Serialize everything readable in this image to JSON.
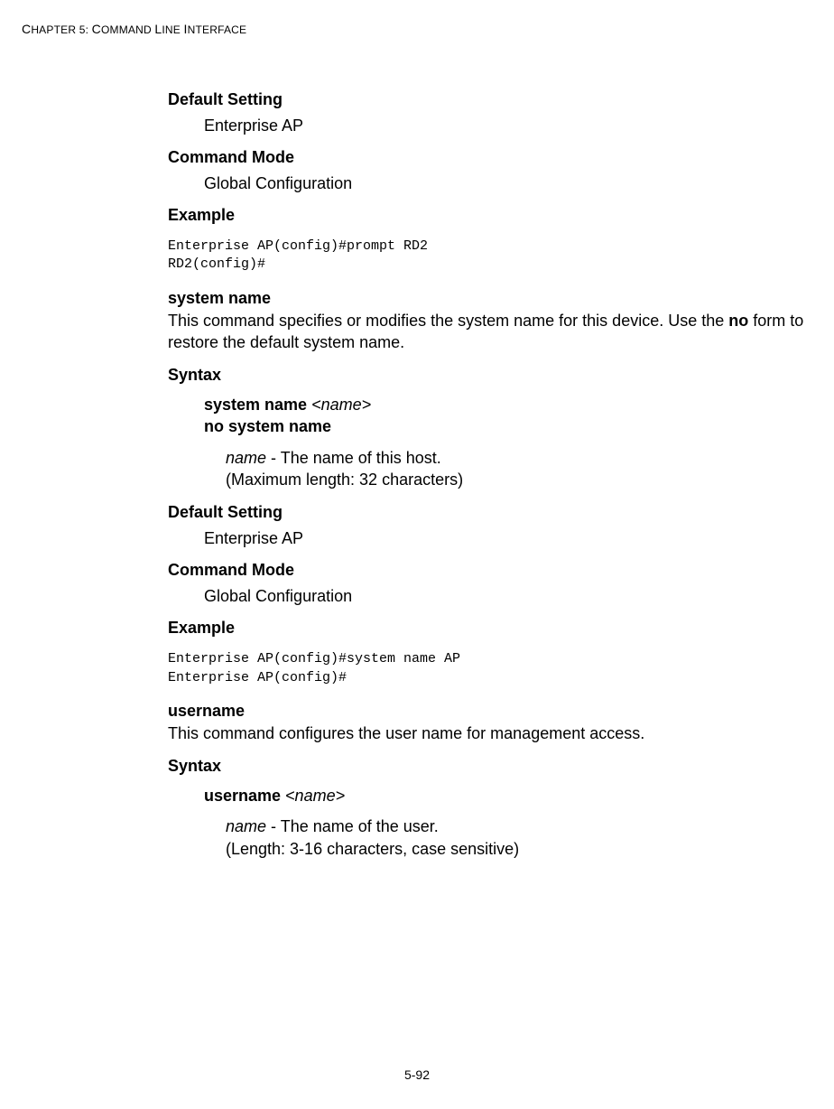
{
  "header": {
    "chapter_label": "CHAPTER 5: COMMAND LINE INTERFACE"
  },
  "sections": {
    "default_setting_1": {
      "title": "Default Setting",
      "value": "Enterprise AP"
    },
    "command_mode_1": {
      "title": "Command Mode",
      "value": "Global Configuration"
    },
    "example_1": {
      "title": "Example",
      "code": "Enterprise AP(config)#prompt RD2\nRD2(config)#"
    },
    "system_name": {
      "title": "system name",
      "description_pre": "This command specifies or modifies the system name for this device. Use the ",
      "description_bold": "no",
      "description_post": " form to restore the default system name.",
      "syntax_title": "Syntax",
      "syntax_l1_bold": "system name",
      "syntax_l1_arg": " <name>",
      "syntax_l2_bold": "no system name",
      "param_name": "name",
      "param_desc_rest": " - The name of this host.",
      "param_note": "(Maximum length: 32 characters)"
    },
    "default_setting_2": {
      "title": "Default Setting",
      "value": "Enterprise AP"
    },
    "command_mode_2": {
      "title": "Command Mode",
      "value": "Global Configuration"
    },
    "example_2": {
      "title": "Example",
      "code": "Enterprise AP(config)#system name AP\nEnterprise AP(config)#"
    },
    "username": {
      "title": "username",
      "description": "This command configures the user name for management access.",
      "syntax_title": "Syntax",
      "syntax_l1_bold": "username",
      "syntax_l1_arg": " <name>",
      "param_name": "name",
      "param_desc_rest": " - The name of the user.",
      "param_note": "(Length: 3-16 characters, case sensitive)"
    }
  },
  "footer": {
    "page": "5-92"
  }
}
